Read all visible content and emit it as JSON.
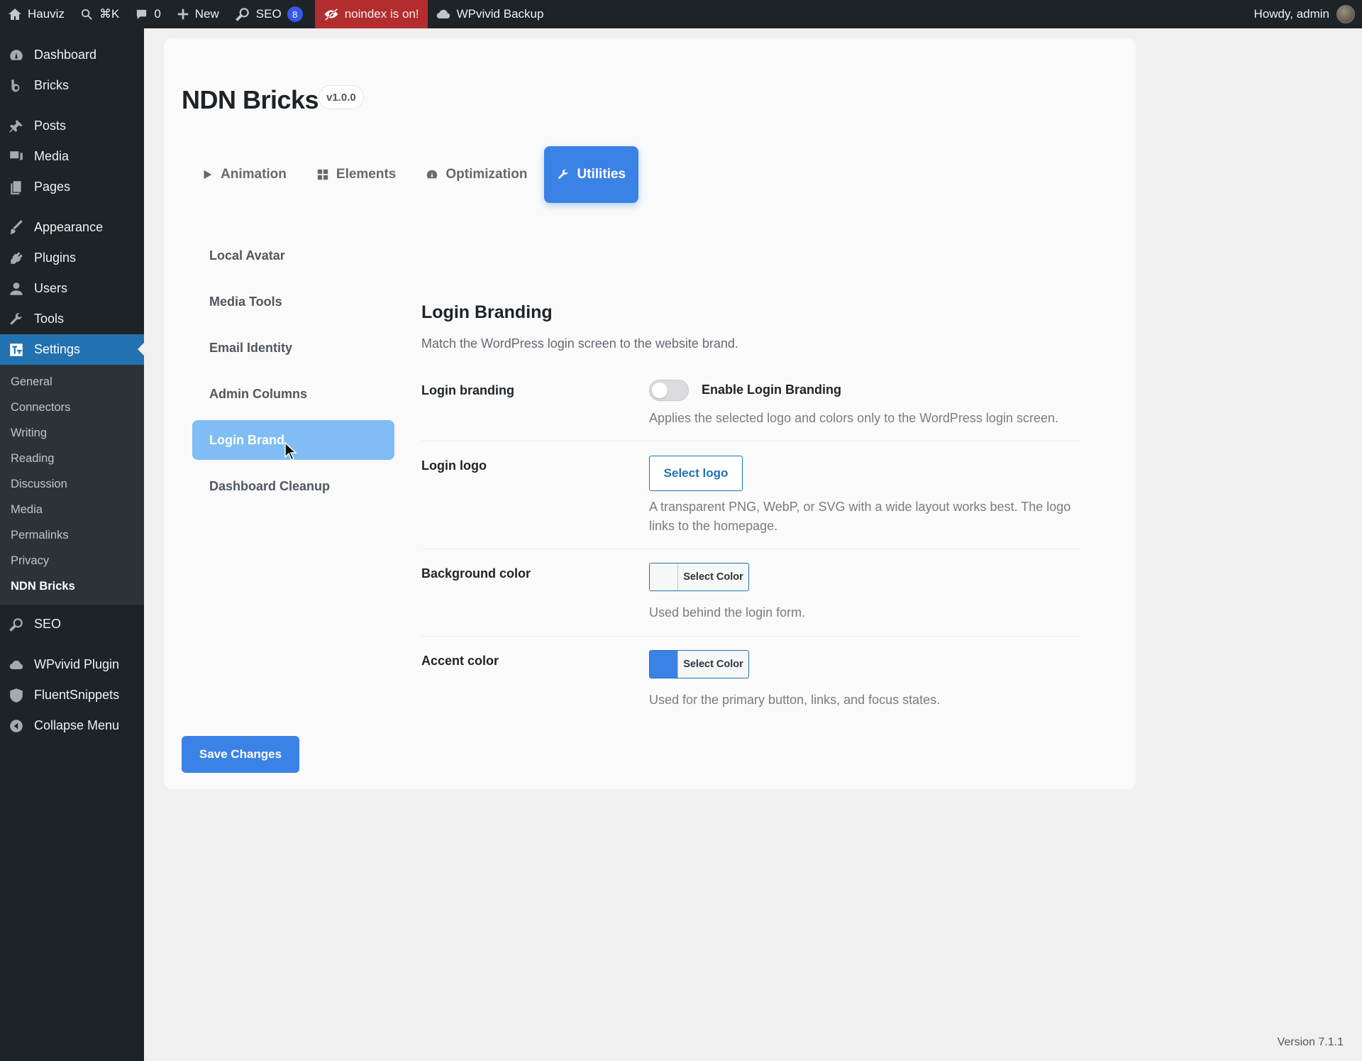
{
  "adminbar": {
    "site_name": "Hauviz",
    "search_shortcut": "⌘K",
    "comments_count": "0",
    "new_label": "New",
    "seo_label": "SEO",
    "seo_badge": "8",
    "noindex_label": "noindex is on!",
    "backup_label": "WPvivid Backup",
    "howdy": "Howdy, admin"
  },
  "sidebar": {
    "items_top": [
      {
        "label": "Dashboard",
        "icon": "dashboard-icon"
      },
      {
        "label": "Bricks",
        "icon": "bricks-icon"
      }
    ],
    "items_content": [
      {
        "label": "Posts",
        "icon": "pin-icon"
      },
      {
        "label": "Media",
        "icon": "media-icon"
      },
      {
        "label": "Pages",
        "icon": "pages-icon"
      }
    ],
    "items_admin": [
      {
        "label": "Appearance",
        "icon": "brush-icon"
      },
      {
        "label": "Plugins",
        "icon": "plug-icon"
      },
      {
        "label": "Users",
        "icon": "user-icon"
      },
      {
        "label": "Tools",
        "icon": "wrench-icon"
      },
      {
        "label": "Settings",
        "icon": "settings-icon"
      }
    ],
    "settings_submenu": [
      "General",
      "Connectors",
      "Writing",
      "Reading",
      "Discussion",
      "Media",
      "Permalinks",
      "Privacy",
      "NDN Bricks"
    ],
    "items_bottom": [
      {
        "label": "SEO",
        "icon": "seo-icon"
      },
      {
        "label": "WPvivid Plugin",
        "icon": "cloud-icon"
      },
      {
        "label": "FluentSnippets",
        "icon": "shield-icon"
      },
      {
        "label": "Collapse Menu",
        "icon": "collapse-icon"
      }
    ]
  },
  "page": {
    "title": "NDN Bricks",
    "version": "v1.0.0",
    "tabs": [
      "Animation",
      "Elements",
      "Optimization",
      "Utilities"
    ],
    "subnav": [
      "Local Avatar",
      "Media Tools",
      "Email Identity",
      "Admin Columns",
      "Login Branding",
      "Dashboard Cleanup"
    ],
    "subnav_active_visible_text": "Login Brand",
    "panel": {
      "title": "Login Branding",
      "description": "Match the WordPress login screen to the website brand.",
      "login_branding_label": "Login branding",
      "toggle_label": "Enable Login Branding",
      "toggle_enabled": false,
      "login_branding_help": "Applies the selected logo and colors only to the WordPress login screen.",
      "login_logo_label": "Login logo",
      "select_logo": "Select logo",
      "login_logo_help": "A transparent PNG, WebP, or SVG with a wide layout works best. The logo links to the homepage.",
      "bg_color_label": "Background color",
      "select_color": "Select Color",
      "bg_color_help": "Used behind the login form.",
      "bg_swatch": "#f6f7f7",
      "accent_color_label": "Accent color",
      "accent_color_help": "Used for the primary button, links, and focus states.",
      "accent_swatch": "#3b82e6"
    },
    "save_label": "Save Changes"
  },
  "footer": {
    "version": "Version 7.1.1"
  }
}
